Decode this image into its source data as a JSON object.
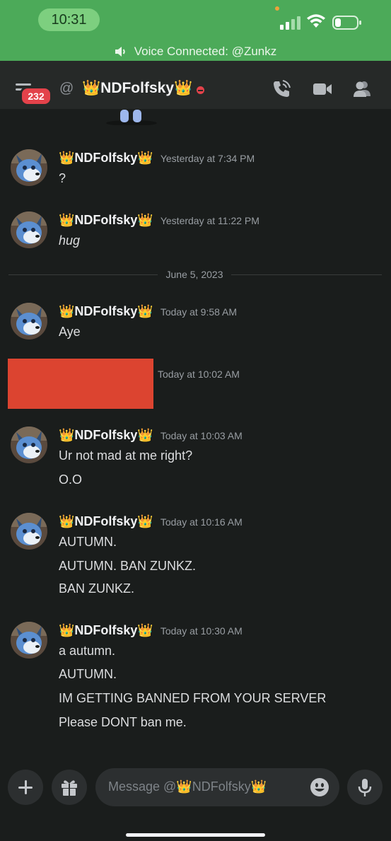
{
  "status_bar": {
    "time": "10:31"
  },
  "voice": {
    "text": "Voice Connected: @Zunkz"
  },
  "header": {
    "badge_count": "232",
    "at_symbol": "@",
    "dm_name": "👑NDFolfsky👑"
  },
  "divider": {
    "date": "June 5, 2023"
  },
  "messages": [
    {
      "author": "👑NDFolfsky👑",
      "timestamp": "Yesterday at 7:34 PM",
      "lines": [
        "?"
      ]
    },
    {
      "author": "👑NDFolfsky👑",
      "timestamp": "Yesterday at 11:22 PM",
      "lines": [
        "hug"
      ]
    },
    {
      "author": "👑NDFolfsky👑",
      "timestamp": "Today at 9:58 AM",
      "lines": [
        "Aye"
      ]
    },
    {
      "author": "",
      "timestamp": "Today at 10:02 AM",
      "lines": []
    },
    {
      "author": "👑NDFolfsky👑",
      "timestamp": "Today at 10:03 AM",
      "lines": [
        "Ur not mad at me right?",
        "O.O"
      ]
    },
    {
      "author": "👑NDFolfsky👑",
      "timestamp": "Today at 10:16 AM",
      "lines": [
        "AUTUMN.",
        "AUTUMN. BAN ZUNKZ.",
        "BAN ZUNKZ."
      ]
    },
    {
      "author": "👑NDFolfsky👑",
      "timestamp": "Today at 10:30 AM",
      "lines": [
        "a autumn.",
        "AUTUMN.",
        "IM GETTING BANNED FROM YOUR SERVER",
        "Please DONT ban me."
      ]
    }
  ],
  "input": {
    "placeholder": "Message @👑NDFolfsky👑"
  },
  "icons": {
    "menu": "hamburger-icon",
    "call": "phone-icon",
    "video": "video-icon",
    "members": "members-icon",
    "add": "plus-icon",
    "gift": "gift-icon",
    "emoji": "emoji-icon",
    "mic": "microphone-icon"
  },
  "colors": {
    "voice_bar": "#4caa59",
    "background": "#1a1d1c",
    "header": "#262928",
    "badge": "#e3424a",
    "redaction": "#dc4430"
  }
}
